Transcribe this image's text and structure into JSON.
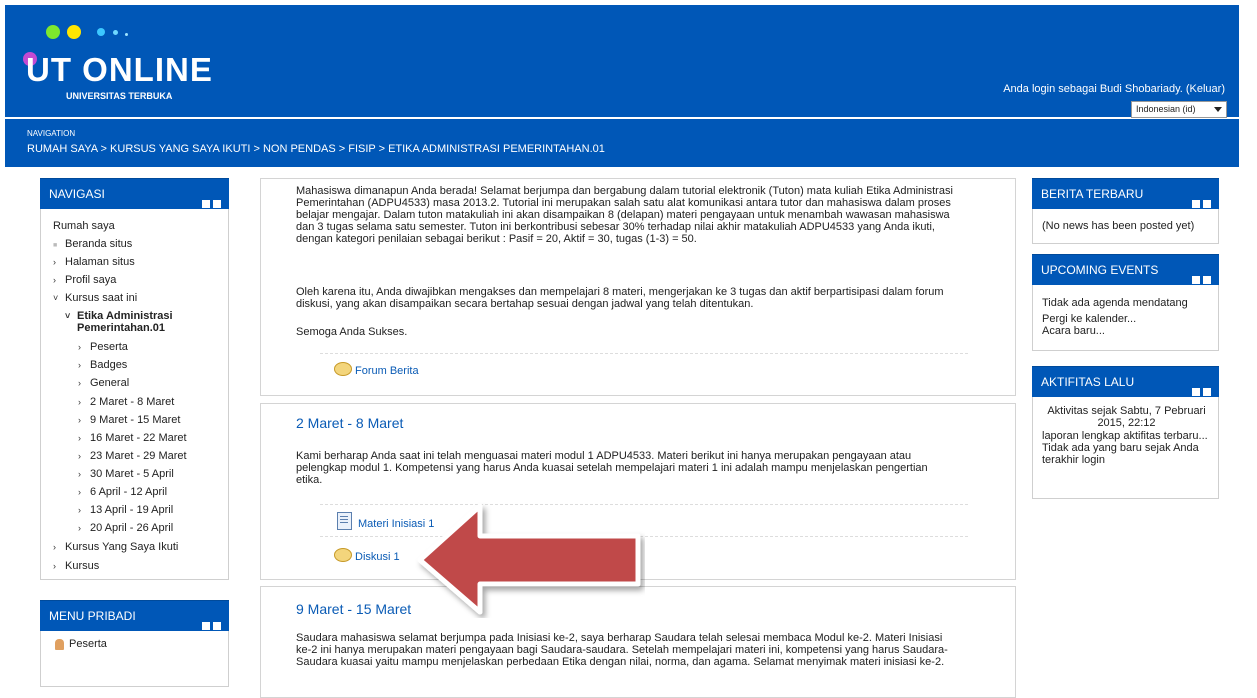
{
  "header": {
    "logo_title": "UT ONLINE",
    "logo_subtitle": "UNIVERSITAS TERBUKA",
    "login_text": "Anda login sebagai Budi Shobariady. (Keluar)",
    "language": "Indonesian (id)"
  },
  "navbar": {
    "label": "NAVIGATION",
    "breadcrumb": "RUMAH SAYA > KURSUS YANG SAYA IKUTI > NON PENDAS > FISIP > ETIKA ADMINISTRASI PEMERINTAHAN.01"
  },
  "colors": {
    "brand_blue": "#0057b7",
    "link_blue": "#0a5bb5",
    "arrow_red": "#c0494a"
  },
  "left": {
    "navigasi_title": "NAVIGASI",
    "items": [
      {
        "label": "Rumah saya",
        "icon": ""
      },
      {
        "label": "Beranda situs",
        "icon": "square-icon"
      },
      {
        "label": "Halaman situs",
        "icon": "chevron-right-icon"
      },
      {
        "label": "Profil saya",
        "icon": "chevron-right-icon"
      },
      {
        "label": "Kursus saat ini",
        "icon": "chevron-down-icon"
      },
      {
        "label": "Etika Administrasi",
        "icon": "chevron-down-icon"
      },
      {
        "label": "Pemerintahan.01",
        "icon": ""
      },
      {
        "label": "Peserta",
        "icon": "chevron-right-icon"
      },
      {
        "label": "Badges",
        "icon": "chevron-right-icon"
      },
      {
        "label": "General",
        "icon": "chevron-right-icon"
      },
      {
        "label": "2 Maret - 8 Maret",
        "icon": "chevron-right-icon"
      },
      {
        "label": "9 Maret - 15 Maret",
        "icon": "chevron-right-icon"
      },
      {
        "label": "16 Maret - 22 Maret",
        "icon": "chevron-right-icon"
      },
      {
        "label": "23 Maret - 29 Maret",
        "icon": "chevron-right-icon"
      },
      {
        "label": "30 Maret - 5 April",
        "icon": "chevron-right-icon"
      },
      {
        "label": "6 April - 12 April",
        "icon": "chevron-right-icon"
      },
      {
        "label": "13 April - 19 April",
        "icon": "chevron-right-icon"
      },
      {
        "label": "20 April - 26 April",
        "icon": "chevron-right-icon"
      },
      {
        "label": "Kursus Yang Saya Ikuti",
        "icon": "chevron-right-icon"
      },
      {
        "label": "Kursus",
        "icon": "chevron-right-icon"
      }
    ],
    "menu_pribadi_title": "MENU PRIBADI",
    "menu_pribadi_item": "Peserta"
  },
  "main": {
    "intro": [
      "Mahasiswa dimanapun Anda berada! Selamat berjumpa dan bergabung dalam tutorial elektronik (Tuton) mata kuliah Etika Administrasi",
      "Pemerintahan (ADPU4533) masa 2013.2. Tutorial ini merupakan salah satu alat komunikasi antara tutor dan mahasiswa dalam proses",
      "belajar mengajar. Dalam tuton matakuliah ini akan disampaikan 8 (delapan) materi pengayaan untuk menambah wawasan mahasiswa",
      "dan 3 tugas selama satu semester. Tuton ini berkontribusi sebesar 30% terhadap nilai akhir matakuliah ADPU4533 yang Anda ikuti,",
      "dengan kategori penilaian sebagai berikut : Pasif = 20, Aktif = 30, tugas (1-3) = 50."
    ],
    "intro2": [
      "Oleh karena itu, Anda diwajibkan mengakses dan mempelajari 8 materi, mengerjakan ke 3 tugas dan aktif berpartisipasi dalam forum",
      "diskusi, yang akan disampaikan secara bertahap sesuai dengan jadwal yang telah ditentukan."
    ],
    "intro3": "Semoga Anda Sukses.",
    "forum": "Forum Berita",
    "sec1": {
      "title": "2 Maret - 8 Maret",
      "text": [
        "Kami berharap Anda saat ini telah menguasai materi modul 1 ADPU4533. Materi berikut ini hanya merupakan pengayaan atau",
        "pelengkap modul 1. Kompetensi yang harus Anda kuasai setelah mempelajari materi 1 ini adalah mampu menjelaskan pengertian",
        "etika."
      ],
      "act1": "Materi Inisiasi 1",
      "act2": "Diskusi 1"
    },
    "sec2": {
      "title": "9 Maret - 15 Maret",
      "text": [
        "Saudara mahasiswa selamat berjumpa pada Inisiasi ke-2, saya berharap Saudara telah selesai membaca Modul ke-2. Materi Inisiasi",
        "ke-2 ini hanya merupakan materi pengayaan bagi Saudara-saudara. Setelah mempelajari materi ini, kompetensi yang harus Saudara-",
        "Saudara kuasai yaitu mampu menjelaskan perbedaan Etika dengan nilai, norma, dan agama. Selamat menyimak materi inisiasi ke-2."
      ]
    }
  },
  "right": {
    "berita_title": "BERITA TERBARU",
    "berita_text": "(No news has been posted yet)",
    "events_title": "UPCOMING EVENTS",
    "events_text": "Tidak ada agenda mendatang",
    "events_link1": "Pergi ke kalender...",
    "events_link2": "Acara baru...",
    "aktif_title": "AKTIFITAS LALU",
    "aktif_line1": "Aktivitas sejak Sabtu, 7 Pebruari",
    "aktif_line2": "2015, 22:12",
    "aktif_link": "laporan lengkap aktifitas terbaru...",
    "aktif_text1": "Tidak ada yang baru sejak Anda",
    "aktif_text2": "terakhir login"
  }
}
